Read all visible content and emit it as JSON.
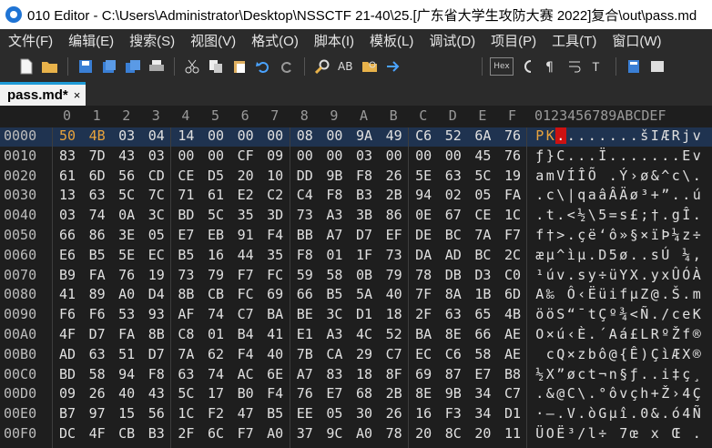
{
  "window": {
    "title": "010 Editor - C:\\Users\\Administrator\\Desktop\\NSSCTF 21-40\\25.[广东省大学生攻防大赛 2022]复合\\out\\pass.md"
  },
  "menu": [
    "文件(F)",
    "编辑(E)",
    "搜索(S)",
    "视图(V)",
    "格式(O)",
    "脚本(I)",
    "模板(L)",
    "调试(D)",
    "项目(P)",
    "工具(T)",
    "窗口(W)"
  ],
  "toolbar": {
    "hex_label": "Hex"
  },
  "tab": {
    "label": "pass.md*",
    "close": "×"
  },
  "editor": {
    "col_headers": [
      "0",
      "1",
      "2",
      "3",
      "4",
      "5",
      "6",
      "7",
      "8",
      "9",
      "A",
      "B",
      "C",
      "D",
      "E",
      "F"
    ],
    "ascii_header": "0123456789ABCDEF",
    "rows": [
      {
        "addr": "0000",
        "hex": [
          "50",
          "4B",
          "03",
          "04",
          "14",
          "00",
          "00",
          "00",
          "08",
          "00",
          "9A",
          "49",
          "C6",
          "52",
          "6A",
          "76"
        ],
        "ascii": "PK........šIÆRjv"
      },
      {
        "addr": "0010",
        "hex": [
          "83",
          "7D",
          "43",
          "03",
          "00",
          "00",
          "CF",
          "09",
          "00",
          "00",
          "03",
          "00",
          "00",
          "00",
          "45",
          "76"
        ],
        "ascii": "ƒ}C...Ï.......Ev"
      },
      {
        "addr": "0020",
        "hex": [
          "61",
          "6D",
          "56",
          "CD",
          "CE",
          "D5",
          "20",
          "10",
          "DD",
          "9B",
          "F8",
          "26",
          "5E",
          "63",
          "5C",
          "19"
        ],
        "ascii": "amVÍÎÕ .Ý›ø&^c\\."
      },
      {
        "addr": "0030",
        "hex": [
          "13",
          "63",
          "5C",
          "7C",
          "71",
          "61",
          "E2",
          "C2",
          "C4",
          "F8",
          "B3",
          "2B",
          "94",
          "02",
          "05",
          "FA"
        ],
        "ascii": ".c\\|qaâÂÄø³+”..ú"
      },
      {
        "addr": "0040",
        "hex": [
          "03",
          "74",
          "0A",
          "3C",
          "BD",
          "5C",
          "35",
          "3D",
          "73",
          "A3",
          "3B",
          "86",
          "0E",
          "67",
          "CE",
          "1C"
        ],
        "ascii": ".t.<½\\5=s£;†.gÎ."
      },
      {
        "addr": "0050",
        "hex": [
          "66",
          "86",
          "3E",
          "05",
          "E7",
          "EB",
          "91",
          "F4",
          "BB",
          "A7",
          "D7",
          "EF",
          "DE",
          "BC",
          "7A",
          "F7"
        ],
        "ascii": "f†>.çë‘ô»§×ïÞ¼z÷"
      },
      {
        "addr": "0060",
        "hex": [
          "E6",
          "B5",
          "5E",
          "EC",
          "B5",
          "16",
          "44",
          "35",
          "F8",
          "01",
          "1F",
          "73",
          "DA",
          "AD",
          "BC",
          "2C"
        ],
        "ascii": "æµ^ìµ.D5ø..sÚ­¼,"
      },
      {
        "addr": "0070",
        "hex": [
          "B9",
          "FA",
          "76",
          "19",
          "73",
          "79",
          "F7",
          "FC",
          "59",
          "58",
          "0B",
          "79",
          "78",
          "DB",
          "D3",
          "C0"
        ],
        "ascii": "¹úv.sy÷üYX.yxÛÓÀ"
      },
      {
        "addr": "0080",
        "hex": [
          "41",
          "89",
          "A0",
          "D4",
          "8B",
          "CB",
          "FC",
          "69",
          "66",
          "B5",
          "5A",
          "40",
          "7F",
          "8A",
          "1B",
          "6D"
        ],
        "ascii": "A‰ Ô‹ËüifµZ@.Š.m"
      },
      {
        "addr": "0090",
        "hex": [
          "F6",
          "F6",
          "53",
          "93",
          "AF",
          "74",
          "C7",
          "BA",
          "BE",
          "3C",
          "D1",
          "18",
          "2F",
          "63",
          "65",
          "4B"
        ],
        "ascii": "ööS“¯tÇº¾<Ñ./ceK"
      },
      {
        "addr": "00A0",
        "hex": [
          "4F",
          "D7",
          "FA",
          "8B",
          "C8",
          "01",
          "B4",
          "41",
          "E1",
          "A3",
          "4C",
          "52",
          "BA",
          "8E",
          "66",
          "AE"
        ],
        "ascii": "O×ú‹È.´Aá£LRºŽf®"
      },
      {
        "addr": "00B0",
        "hex": [
          "AD",
          "63",
          "51",
          "D7",
          "7A",
          "62",
          "F4",
          "40",
          "7B",
          "CA",
          "29",
          "C7",
          "EC",
          "C6",
          "58",
          "AE"
        ],
        "ascii": "­cQ×zbô@{Ê)ÇìÆX®"
      },
      {
        "addr": "00C0",
        "hex": [
          "BD",
          "58",
          "94",
          "F8",
          "63",
          "74",
          "AC",
          "6E",
          "A7",
          "83",
          "18",
          "8F",
          "69",
          "87",
          "E7",
          "B8"
        ],
        "ascii": "½X”øct¬n§ƒ..i‡ç¸"
      },
      {
        "addr": "00D0",
        "hex": [
          "09",
          "26",
          "40",
          "43",
          "5C",
          "17",
          "B0",
          "F4",
          "76",
          "E7",
          "68",
          "2B",
          "8E",
          "9B",
          "34",
          "C7"
        ],
        "ascii": ".&@C\\.°ôvçh+Ž›4Ç"
      },
      {
        "addr": "00E0",
        "hex": [
          "B7",
          "97",
          "15",
          "56",
          "1C",
          "F2",
          "47",
          "B5",
          "EE",
          "05",
          "30",
          "26",
          "16",
          "F3",
          "34",
          "D1"
        ],
        "ascii": "·—.V.òGµî.0&.ó4Ñ"
      },
      {
        "addr": "00F0",
        "hex": [
          "DC",
          "4F",
          "CB",
          "B3",
          "2F",
          "6C",
          "F7",
          "A0",
          "37",
          "9C",
          "A0",
          "78",
          "20",
          "8C",
          "20",
          "11"
        ],
        "ascii": "ÜOË³/l÷ 7œ x Œ ."
      }
    ]
  }
}
